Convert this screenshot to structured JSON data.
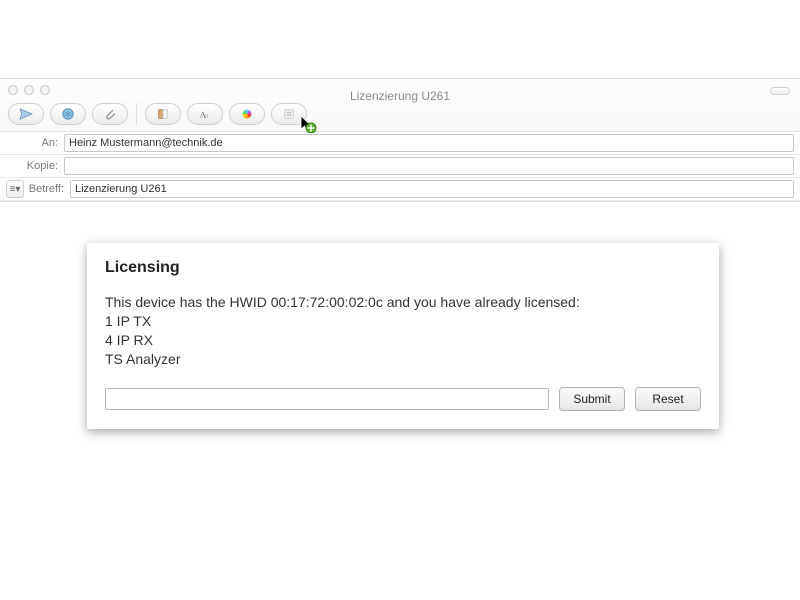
{
  "mail": {
    "window_title": "Lizenzierung U261",
    "fields": {
      "to_label": "An:",
      "to_value": "Heinz Mustermann@technik.de",
      "cc_label": "Kopie:",
      "cc_value": "",
      "subject_label": "Betreff:",
      "subject_value": "Lizenzierung U261"
    },
    "toolbar_icons": [
      "send-icon",
      "globe-icon",
      "attach-icon",
      "address-icon",
      "fonts-icon",
      "color-icon",
      "list-icon"
    ],
    "menu_toggle_glyph": "≡▾"
  },
  "licensing": {
    "heading": "Licensing",
    "intro": "This device has the HWID 00:17:72:00:02:0c and you have already licensed:",
    "items": [
      "1 IP TX",
      "4 IP RX",
      "TS Analyzer"
    ],
    "input_value": "",
    "submit_label": "Submit",
    "reset_label": "Reset"
  }
}
